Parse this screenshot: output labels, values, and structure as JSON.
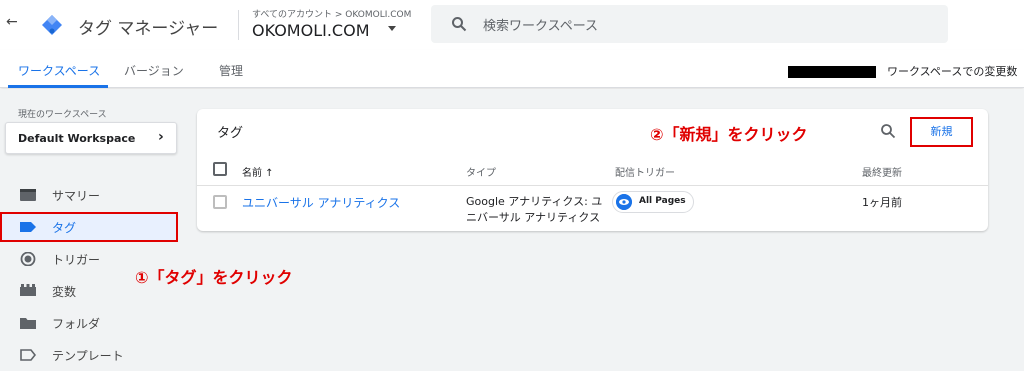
{
  "header": {
    "back_icon": "arrow-left-icon",
    "logo_icon": "tag-manager-logo",
    "app_title": "タグ マネージャー",
    "account_path": "すべてのアカウント > OKOMOLI.COM",
    "account_name": "OKOMOLI.COM",
    "search_placeholder": "検索ワークスペース"
  },
  "tabs": [
    {
      "label": "ワークスペース",
      "active": true
    },
    {
      "label": "バージョン",
      "active": false
    },
    {
      "label": "管理",
      "active": false
    }
  ],
  "workspace_changes": "ワークスペースでの変更数",
  "sidebar": {
    "current_workspace_label": "現在のワークスペース",
    "workspace_name": "Default Workspace",
    "items": [
      {
        "label": "サマリー",
        "icon": "folder-icon",
        "active": false
      },
      {
        "label": "タグ",
        "icon": "tag-icon",
        "active": true
      },
      {
        "label": "トリガー",
        "icon": "trigger-icon",
        "active": false
      },
      {
        "label": "変数",
        "icon": "variables-icon",
        "active": false
      },
      {
        "label": "フォルダ",
        "icon": "folder-icon",
        "active": false
      },
      {
        "label": "テンプレート",
        "icon": "template-icon",
        "active": false
      }
    ]
  },
  "tags_card": {
    "title": "タグ",
    "new_button": "新規",
    "columns": {
      "name": "名前 ↑",
      "type": "タイプ",
      "trigger": "配信トリガー",
      "updated": "最終更新"
    },
    "rows": [
      {
        "name": "ユニバーサル アナリティクス",
        "type": "Google アナリティクス: ユニバーサル アナリティクス",
        "trigger": "All Pages",
        "updated": "1ヶ月前"
      }
    ]
  },
  "annotations": {
    "step1": "①「タグ」をクリック",
    "step2": "②「新規」をクリック"
  },
  "colors": {
    "accent": "#1a73e8",
    "annotation": "#e00000",
    "body_bg": "#f1f3f4"
  }
}
